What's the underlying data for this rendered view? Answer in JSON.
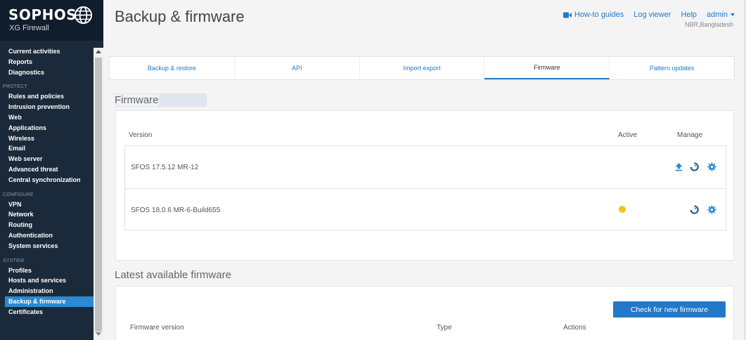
{
  "brand": {
    "name": "SOPHOS",
    "product": "XG Firewall"
  },
  "sidebar": {
    "top_items": [
      {
        "label": "Current activities"
      },
      {
        "label": "Reports"
      },
      {
        "label": "Diagnostics"
      }
    ],
    "sections": [
      {
        "label": "PROTECT",
        "items": [
          {
            "label": "Rules and policies"
          },
          {
            "label": "Intrusion prevention"
          },
          {
            "label": "Web"
          },
          {
            "label": "Applications"
          },
          {
            "label": "Wireless"
          },
          {
            "label": "Email"
          },
          {
            "label": "Web server"
          },
          {
            "label": "Advanced threat"
          },
          {
            "label": "Central synchronization"
          }
        ]
      },
      {
        "label": "CONFIGURE",
        "items": [
          {
            "label": "VPN"
          },
          {
            "label": "Network"
          },
          {
            "label": "Routing"
          },
          {
            "label": "Authentication"
          },
          {
            "label": "System services"
          }
        ]
      },
      {
        "label": "SYSTEM",
        "items": [
          {
            "label": "Profiles"
          },
          {
            "label": "Hosts and services"
          },
          {
            "label": "Administration"
          },
          {
            "label": "Backup & firmware",
            "active": true
          },
          {
            "label": "Certificates"
          }
        ]
      }
    ]
  },
  "header": {
    "title": "Backup & firmware",
    "links": {
      "howto": "How-to guides",
      "log_viewer": "Log viewer",
      "help": "Help",
      "admin": "admin"
    },
    "location": "NBR,Bangladesh"
  },
  "tabs": [
    {
      "label": "Backup & restore",
      "active": false
    },
    {
      "label": "API",
      "active": false
    },
    {
      "label": "Import export",
      "active": false
    },
    {
      "label": "Firmware",
      "active": true
    },
    {
      "label": "Pattern updates",
      "active": false
    }
  ],
  "firmware": {
    "title": "Firmware",
    "columns": {
      "version": "Version",
      "active": "Active",
      "manage": "Manage"
    },
    "rows": [
      {
        "version": "SFOS 17.5.12 MR-12",
        "active": false,
        "actions": [
          "upload-icon",
          "reboot-icon",
          "settings-icon"
        ]
      },
      {
        "version": "SFOS 18.0.6 MR-6-Build655",
        "active": true,
        "actions": [
          "reboot-icon",
          "settings-icon"
        ]
      }
    ]
  },
  "latest": {
    "title": "Latest available firmware",
    "check_button": "Check for new firmware",
    "columns": {
      "firmware_version": "Firmware version",
      "type": "Type",
      "actions": "Actions"
    }
  },
  "colors": {
    "sidebar_bg": "#1b2a3a",
    "accent": "#2378c9",
    "active_nav": "#2b8ad0",
    "active_dot": "#f2c21b"
  }
}
